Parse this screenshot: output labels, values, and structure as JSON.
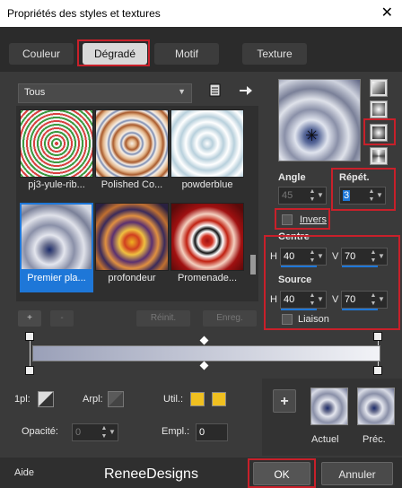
{
  "window": {
    "title": "Propriétés des styles et textures",
    "close_glyph": "✕"
  },
  "tabs": [
    {
      "label": "Couleur"
    },
    {
      "label": "Dégradé"
    },
    {
      "label": "Motif"
    },
    {
      "label": "Texture"
    }
  ],
  "library": {
    "category": "Tous",
    "items": [
      {
        "caption": "pj3-yule-rib..."
      },
      {
        "caption": "Polished Co..."
      },
      {
        "caption": "powderblue"
      },
      {
        "caption": "Premier pla..."
      },
      {
        "caption": "profondeur"
      },
      {
        "caption": "Promenade..."
      }
    ],
    "add_label": "+",
    "remove_label": "-",
    "reset_label": "Réinit.",
    "save_label": "Enreg."
  },
  "gradient": {
    "angle_label": "Angle",
    "angle_value": "45",
    "repeat_label": "Répét.",
    "repeat_value": "3",
    "invert_label": "Invers",
    "center_label": "Centre",
    "center_h_label": "H",
    "center_h_value": "40",
    "center_v_label": "V",
    "center_v_value": "70",
    "source_label": "Source",
    "source_h_label": "H",
    "source_h_value": "40",
    "source_v_label": "V",
    "source_v_value": "70",
    "link_label": "Liaison"
  },
  "editor": {
    "first_label": "1pl:",
    "arrpl_label": "Arpl:",
    "util_label": "Util.:",
    "opacity_label": "Opacité:",
    "opacity_value": "0",
    "empl_label": "Empl.:",
    "empl_value": "0",
    "util_color_1": "#f0c020",
    "util_color_2": "#f0c020"
  },
  "swatches": {
    "add_label": "+",
    "current_label": "Actuel",
    "previous_label": "Préc."
  },
  "footer": {
    "help_label": "Aide",
    "watermark": "ReneeDesigns",
    "ok_label": "OK",
    "cancel_label": "Annuler"
  },
  "colors": {
    "highlight_red": "#c8202a",
    "selection_blue": "#1e77d8"
  }
}
